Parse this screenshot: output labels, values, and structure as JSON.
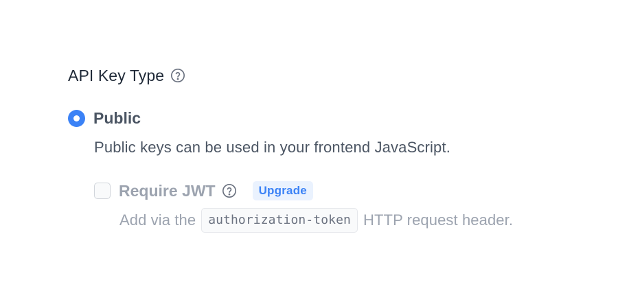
{
  "section": {
    "title": "API Key Type",
    "help_icon": "question-circle-icon"
  },
  "option": {
    "label": "Public",
    "description": "Public keys can be used in your frontend JavaScript.",
    "selected": true
  },
  "sub_option": {
    "label": "Require JWT",
    "help_icon": "question-circle-icon",
    "badge": "Upgrade",
    "checked": false,
    "desc_before": "Add via the",
    "code": "authorization-token",
    "desc_after": "HTTP request header."
  },
  "colors": {
    "accent": "#3b82f6",
    "badge_bg": "#eaf2fe",
    "text_primary": "#1f2937",
    "text_secondary": "#4b5563",
    "text_muted": "#9ca3af"
  }
}
